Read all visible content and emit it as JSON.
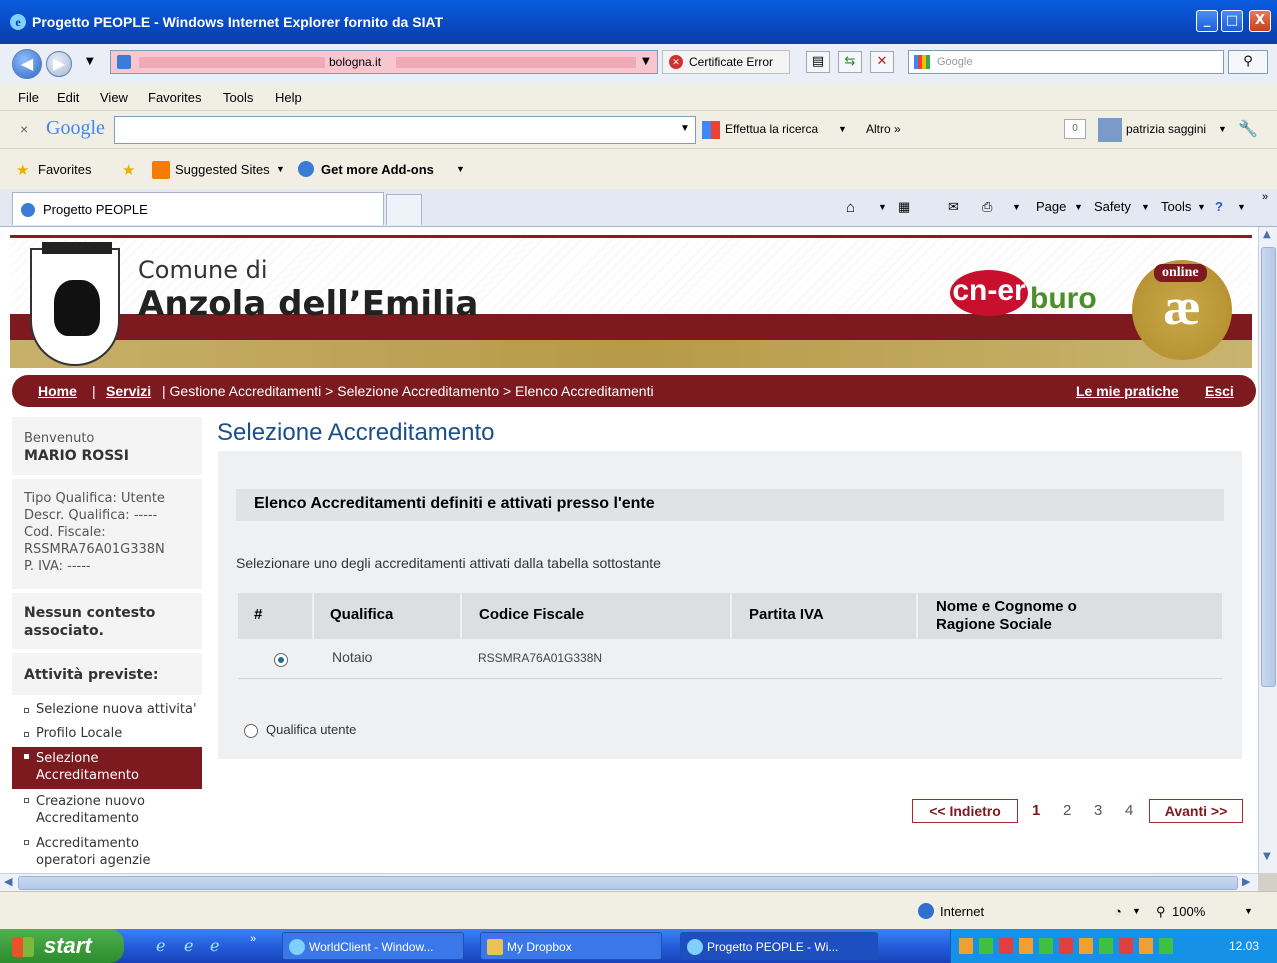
{
  "window": {
    "title": "Progetto PEOPLE - Windows Internet Explorer fornito da SIAT",
    "buttons": [
      "_",
      "□",
      "X"
    ]
  },
  "addressbar": {
    "url_visible": "bologna.it",
    "cert_label": "Certificate Error",
    "search_placeholder": "Google"
  },
  "menu": [
    "File",
    "Edit",
    "View",
    "Favorites",
    "Tools",
    "Help"
  ],
  "google_toolbar": {
    "logo": "Google",
    "search_button": "Effettua la ricerca",
    "more": "Altro »",
    "user": "patrizia saggini",
    "count": "0"
  },
  "favorites_bar": {
    "favorites": "Favorites",
    "suggested": "Suggested Sites",
    "addons": "Get more Add-ons"
  },
  "tab": {
    "title": "Progetto PEOPLE"
  },
  "command_bar": {
    "page": "Page",
    "safety": "Safety",
    "tools": "Tools"
  },
  "header": {
    "line1": "Comune di",
    "line2": "Anzola dell’Emilia",
    "logo_cner": "cn-er",
    "logo_buro": "buro",
    "logo_online": "online",
    "logo_ae": "æ"
  },
  "breadcrumb": {
    "home": "Home",
    "servizi": "Servizi",
    "path": "| Gestione Accreditamenti > Selezione Accreditamento > Elenco Accreditamenti",
    "pratiche": "Le mie pratiche",
    "esci": "Esci",
    "sep": "|"
  },
  "sidebar": {
    "welcome_label": "Benvenuto",
    "user_name": "MARIO ROSSI",
    "qualifica_tipo": "Tipo Qualifica: Utente",
    "qualifica_descr": "Descr. Qualifica: -----",
    "cod_fiscale_label": "Cod. Fiscale:",
    "cod_fiscale": "RSSMRA76A01G338N",
    "piva": "P. IVA: -----",
    "contesto1": "Nessun contesto",
    "contesto2": "associato.",
    "attivita": "Attività previste:",
    "items": [
      {
        "l1": "Selezione nuova attivita'",
        "l2": ""
      },
      {
        "l1": "Profilo Locale",
        "l2": ""
      },
      {
        "l1": "Selezione",
        "l2": "Accreditamento"
      },
      {
        "l1": "Creazione nuovo",
        "l2": "Accreditamento"
      },
      {
        "l1": "Accreditamento",
        "l2": "operatori agenzie"
      }
    ]
  },
  "main": {
    "title": "Selezione Accreditamento",
    "panel_header": "Elenco Accreditamenti definiti e attivati presso l'ente",
    "instructions": "Selezionare uno degli accreditamenti attivati dalla tabella sottostante",
    "table": {
      "columns": [
        "#",
        "Qualifica",
        "Codice Fiscale",
        "Partita IVA",
        "Nome e Cognome o",
        "Ragione Sociale"
      ],
      "rows": [
        {
          "qualifica": "Notaio",
          "cf": "RSSMRA76A01G338N",
          "piva": "",
          "nome": ""
        }
      ]
    },
    "qualifica_utente": "Qualifica utente"
  },
  "pager": {
    "prev": "<< Indietro",
    "pages": [
      "1",
      "2",
      "3",
      "4"
    ],
    "next": "Avanti >>"
  },
  "status": {
    "zone": "Internet",
    "zoom": "100%"
  },
  "taskbar": {
    "start": "start",
    "tasks": [
      "WorldClient - Window...",
      "My Dropbox",
      "Progetto PEOPLE - Wi..."
    ],
    "clock": "12.03"
  }
}
